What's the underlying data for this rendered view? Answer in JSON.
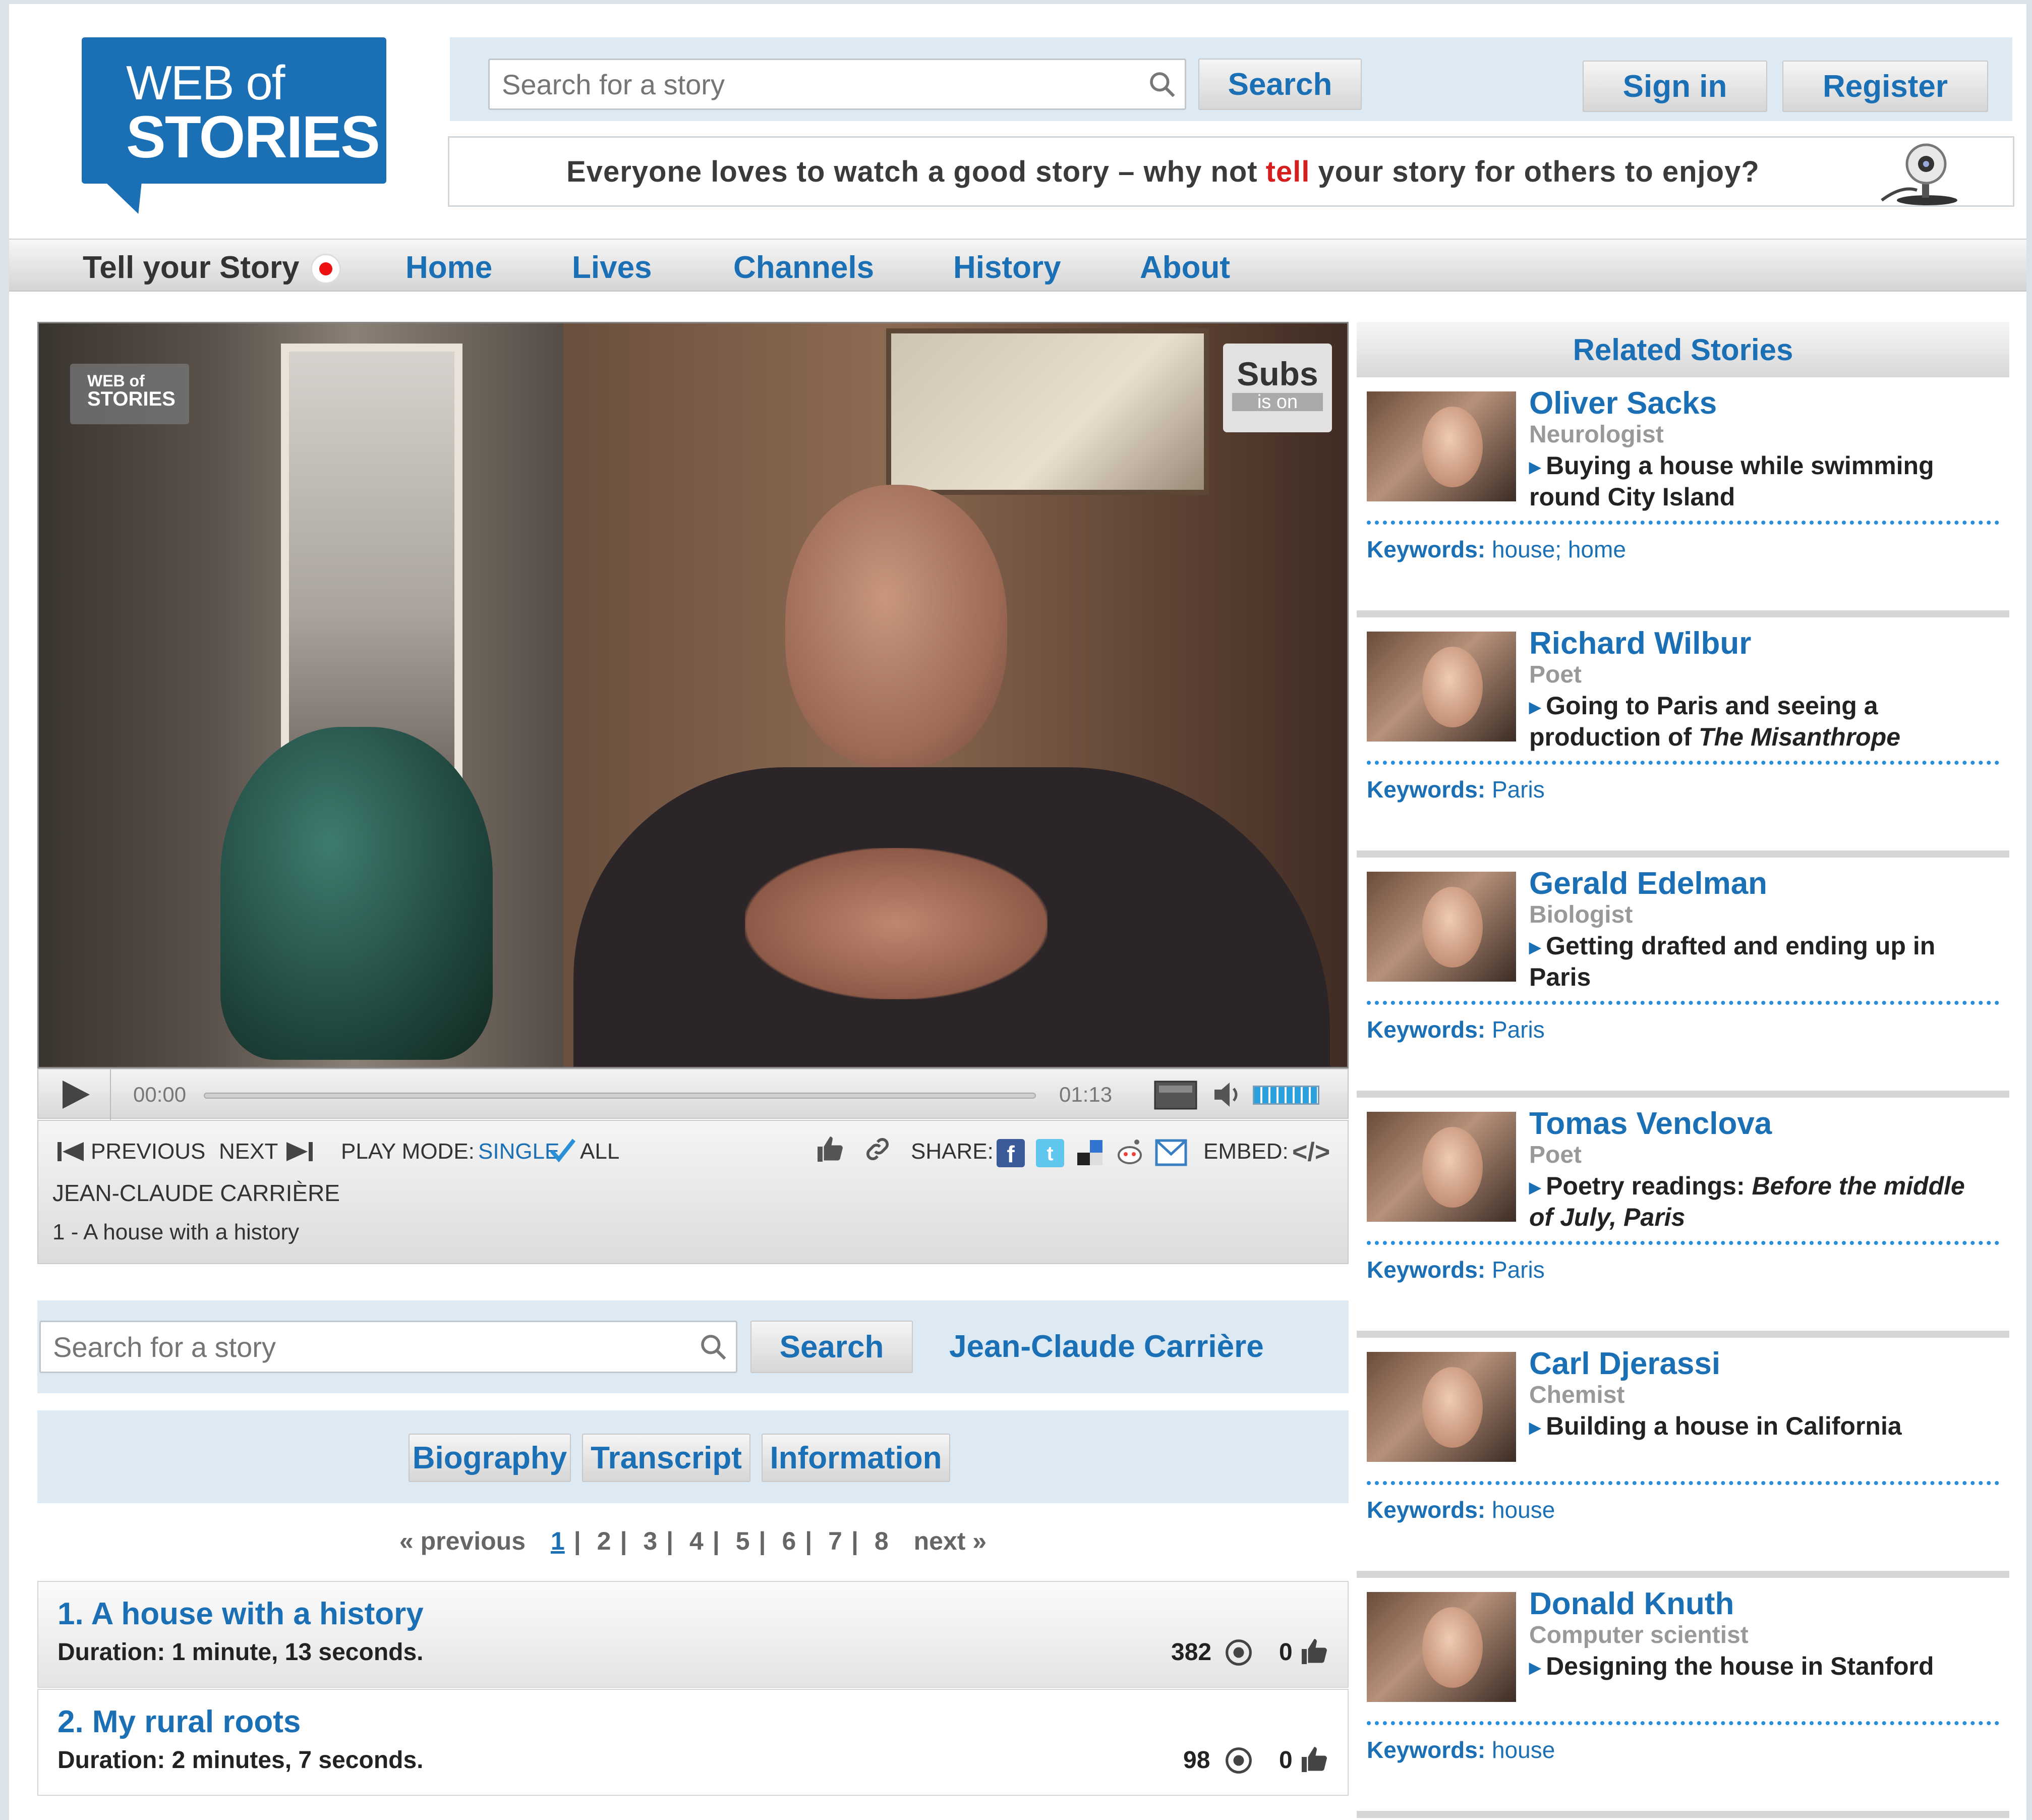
{
  "brand": {
    "line1": "WEB of",
    "line2": "STORIES"
  },
  "header": {
    "search_placeholder": "Search for a story",
    "search_button": "Search",
    "sign_in": "Sign in",
    "register": "Register",
    "tagline_pre": "Everyone loves to watch a good story – why not",
    "tagline_red": "tell",
    "tagline_post": "your story for others to enjoy?"
  },
  "nav": {
    "tell": "Tell your Story",
    "items": [
      "Home",
      "Lives",
      "Channels",
      "History",
      "About"
    ]
  },
  "video": {
    "watermark1": "WEB of",
    "watermark2": "STORIES",
    "subs": "Subs",
    "subs_state": "is on",
    "time_current": "00:00",
    "time_total": "01:13"
  },
  "info": {
    "previous": "PREVIOUS",
    "next": "NEXT",
    "play_mode_label": "PLAY MODE:",
    "mode_single": "SINGLE",
    "mode_all": "ALL",
    "share_label": "SHARE:",
    "embed_label": "EMBED:",
    "speaker": "JEAN-CLAUDE CARRIÈRE",
    "clip": "1 - A house with a history"
  },
  "search2": {
    "placeholder": "Search for a story",
    "button": "Search",
    "speaker_link": "Jean-Claude Carrière"
  },
  "tabs": [
    "Biography",
    "Transcript",
    "Information"
  ],
  "pager": {
    "prev": "« previous",
    "pages": [
      "1",
      "2",
      "3",
      "4",
      "5",
      "6",
      "7",
      "8"
    ],
    "current": "1",
    "next": "next »"
  },
  "chapters": [
    {
      "title": "1. A house with a history",
      "duration": "Duration: 1 minute, 13 seconds.",
      "views": "382",
      "likes": "0"
    },
    {
      "title": "2. My rural roots",
      "duration": "Duration: 2 minutes, 7 seconds.",
      "views": "98",
      "likes": "0"
    }
  ],
  "related": {
    "heading": "Related Stories",
    "keywords_label": "Keywords:",
    "stories": [
      {
        "name": "Oliver Sacks",
        "role": "Neurologist",
        "title": "Buying a house while swimming round City Island",
        "keywords": "house; home"
      },
      {
        "name": "Richard Wilbur",
        "role": "Poet",
        "title": "Going to Paris and seeing a production of ",
        "title_em": "The Misanthrope",
        "keywords": "Paris"
      },
      {
        "name": "Gerald Edelman",
        "role": "Biologist",
        "title": "Getting drafted and ending up in Paris",
        "keywords": "Paris"
      },
      {
        "name": "Tomas Venclova",
        "role": "Poet",
        "title": "Poetry readings: ",
        "title_em": "Before the middle of July, Paris",
        "keywords": "Paris"
      },
      {
        "name": "Carl Djerassi",
        "role": "Chemist",
        "title": "Building a house in California",
        "keywords": "house"
      },
      {
        "name": "Donald Knuth",
        "role": "Computer scientist",
        "title": "Designing the house in Stanford",
        "keywords": "house"
      }
    ]
  }
}
